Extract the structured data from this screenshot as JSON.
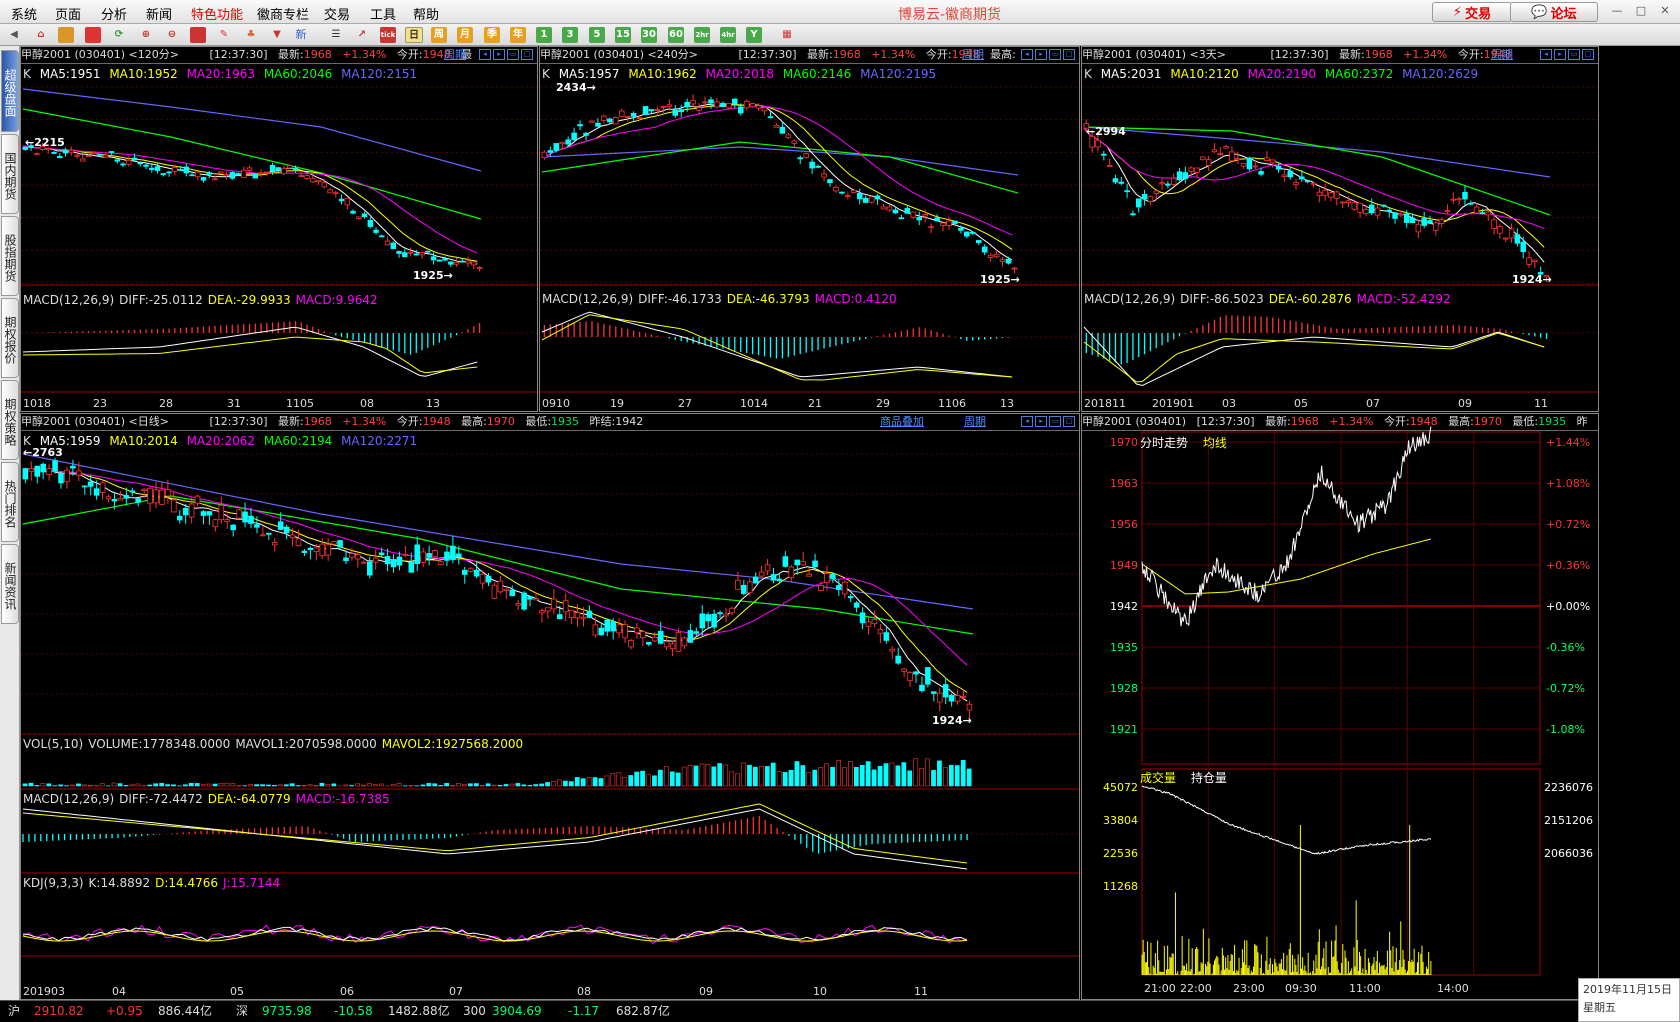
{
  "menu": {
    "items": [
      "系统",
      "页面",
      "分析",
      "新闻",
      "特色功能",
      "徽商专栏",
      "交易",
      "工具",
      "帮助"
    ],
    "app_title": "博易云-徽商期货",
    "trade_button": "交易",
    "forum_button": "论坛"
  },
  "toolbar": {
    "period_buttons": [
      "日",
      "周",
      "月",
      "季",
      "年",
      "1",
      "3",
      "5",
      "15",
      "30",
      "60",
      "2hr",
      "4hr",
      "Y"
    ],
    "new_label": "新"
  },
  "sidebar": {
    "tabs": [
      "超级盘面",
      "国内期货",
      "股指期货",
      "期权报价",
      "期权策略",
      "热门排名",
      "新闻资讯"
    ]
  },
  "panels": {
    "p120": {
      "header": {
        "name": "甲醇2001 (030401) <120分>",
        "time": "[12:37:30]",
        "latest_label": "最新:",
        "latest": "1968",
        "change": "+1.34%",
        "open_label": "今开:",
        "open": "1948",
        "extra": "最",
        "cycle": "周期"
      },
      "legend": {
        "k": "K",
        "ma5": "MA5:1951",
        "ma10": "MA10:1952",
        "ma20": "MA20:1963",
        "ma60": "MA60:2046",
        "ma120": "MA120:2151"
      },
      "high_ann": "←2215",
      "low_ann": "1925→",
      "macd": {
        "name": "MACD(12,26,9)",
        "diff": "DIFF:-25.0112",
        "dea": "DEA:-29.9933",
        "macd": "MACD:9.9642"
      },
      "x_ticks": [
        "1018",
        "23",
        "28",
        "31",
        "1105",
        "08",
        "13"
      ]
    },
    "p240": {
      "header": {
        "name": "甲醇2001 (030401) <240分>",
        "time": "[12:37:30]",
        "latest_label": "最新:",
        "latest": "1968",
        "change": "+1.34%",
        "open_label": "今开:",
        "open": "1948",
        "extra": "最高:",
        "cycle": "周期"
      },
      "legend": {
        "k": "K",
        "ma5": "MA5:1957",
        "ma10": "MA10:1962",
        "ma20": "MA20:2018",
        "ma60": "MA60:2146",
        "ma120": "MA120:2195"
      },
      "high_ann": "2434→",
      "low_ann": "1925→",
      "macd": {
        "name": "MACD(12,26,9)",
        "diff": "DIFF:-46.1733",
        "dea": "DEA:-46.3793",
        "macd": "MACD:0.4120"
      },
      "x_ticks": [
        "0910",
        "19",
        "27",
        "1014",
        "21",
        "29",
        "1106",
        "13"
      ]
    },
    "p3d": {
      "header": {
        "name": "甲醇2001 (030401) <3天>",
        "time": "[12:37:30]",
        "latest_label": "最新:",
        "latest": "1968",
        "change": "+1.34%",
        "open_label": "今开:",
        "open": "1948",
        "extra": "",
        "cycle": "周期"
      },
      "legend": {
        "k": "K",
        "ma5": "MA5:2031",
        "ma10": "MA10:2120",
        "ma20": "MA20:2190",
        "ma60": "MA60:2372",
        "ma120": "MA120:2629"
      },
      "high_ann": "←2994",
      "low_ann": "1924→",
      "macd": {
        "name": "MACD(12,26,9)",
        "diff": "DIFF:-86.5023",
        "dea": "DEA:-60.2876",
        "macd": "MACD:-52.4292"
      },
      "x_ticks": [
        "201811",
        "201901",
        "03",
        "05",
        "07",
        "09",
        "11"
      ]
    },
    "pday": {
      "header": {
        "name": "甲醇2001 (030401) <日线>",
        "time": "[12:37:30]",
        "latest_label": "最新:",
        "latest": "1968",
        "change": "+1.34%",
        "open_label": "今开:",
        "open": "1948",
        "high_label": "最高:",
        "high": "1970",
        "low_label": "最低:",
        "low": "1935",
        "prev_label": "昨结:",
        "prev": "1942",
        "overlay": "商品叠加",
        "cycle": "周期"
      },
      "legend": {
        "k": "K",
        "ma5": "MA5:1959",
        "ma10": "MA10:2014",
        "ma20": "MA20:2062",
        "ma60": "MA60:2194",
        "ma120": "MA120:2271"
      },
      "high_ann": "←2763",
      "low_ann": "1924→",
      "vol": {
        "name": "VOL(5,10)",
        "volume": "VOLUME:1778348.0000",
        "mavol1": "MAVOL1:2070598.0000",
        "mavol2": "MAVOL2:1927568.2000"
      },
      "macd": {
        "name": "MACD(12,26,9)",
        "diff": "DIFF:-72.4472",
        "dea": "DEA:-64.0779",
        "macd": "MACD:-16.7385"
      },
      "kdj": {
        "name": "KDJ(9,3,3)",
        "k": "K:14.8892",
        "d": "D:14.4766",
        "j": "J:15.7144"
      },
      "x_ticks": [
        "201903",
        "04",
        "05",
        "06",
        "07",
        "08",
        "09",
        "10",
        "11"
      ]
    },
    "pintra": {
      "header": {
        "name": "甲醇2001 (030401)",
        "time": "[12:37:30]",
        "latest_label": "最新:",
        "latest": "1968",
        "change": "+1.34%",
        "open_label": "今开:",
        "open": "1948",
        "high_label": "最高:",
        "high": "1970",
        "low_label": "最低:",
        "low": "1935",
        "extra": "昨"
      },
      "title_left": "分时走势",
      "title_avg": "均线",
      "price_ticks": [
        "1970",
        "1963",
        "1956",
        "1949",
        "1942",
        "1935",
        "1928",
        "1921"
      ],
      "pct_ticks": [
        "+1.44%",
        "+1.08%",
        "+0.72%",
        "+0.36%",
        "+0.00%",
        "-0.36%",
        "-0.72%",
        "-1.08%"
      ],
      "vol_title": "成交量",
      "oi_title": "持仓量",
      "vol_ticks": [
        "45072",
        "33804",
        "22536",
        "11268"
      ],
      "oi_ticks": [
        "2236076",
        "2151206",
        "2066036"
      ],
      "x_ticks": [
        "21:00",
        "22:00",
        "23:00",
        "09:30",
        "11:00",
        "14:00"
      ]
    }
  },
  "statusbar": {
    "sh_label": "沪",
    "sh_index": "2910.82",
    "sh_chg": "+0.95",
    "sh_amt": "886.44亿",
    "sz_label": "深",
    "sz_index": "9735.98",
    "sz_chg": "-10.58",
    "sz_amt": "1482.88亿",
    "c300_label": "300",
    "c300_index": "3904.69",
    "c300_chg": "-1.17",
    "c300_amt": "682.87亿"
  },
  "datebox": {
    "date": "2019年11月15日",
    "weekday": "星期五"
  },
  "colors": {
    "up": "#ff3232",
    "down": "#00ffff",
    "ma5": "#ffffff",
    "ma10": "#ffff00",
    "ma20": "#ff00ff",
    "ma60": "#00ff00",
    "ma120": "#6666ff"
  }
}
